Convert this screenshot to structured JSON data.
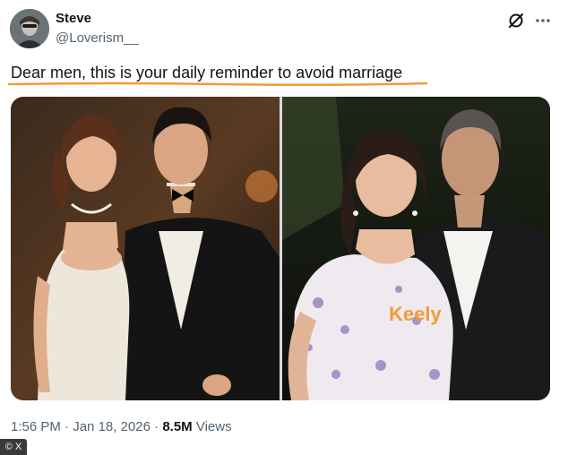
{
  "author": {
    "name": "Steve",
    "handle": "@Loverism__"
  },
  "tweet": {
    "text": "Dear men, this is your daily reminder to avoid marriage",
    "underline_color": "#f39a3a"
  },
  "media": {
    "right_photo_label": "Keely"
  },
  "meta": {
    "time": "1:56 PM",
    "sep1": " · ",
    "date": "Jan 18, 2026",
    "sep2": " · ",
    "views_count": "8.5M",
    "views_label": " Views"
  },
  "watermark": "© X",
  "icons": {
    "grok": "grok-icon",
    "more": "more-icon"
  }
}
